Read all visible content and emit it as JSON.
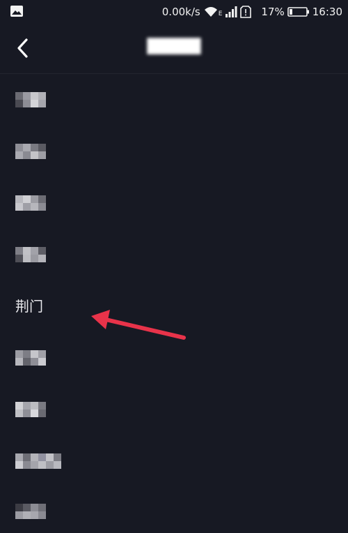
{
  "status_bar": {
    "network_speed": "0.00k/s",
    "network_type": "E",
    "battery_percent": "17%",
    "battery_level": 0.17,
    "time": "16:30",
    "icons": [
      "image-icon",
      "wifi-icon",
      "signal-icon",
      "sim-alert-icon",
      "battery-icon"
    ]
  },
  "header": {
    "back_icon": "chevron-left-icon",
    "title": "█████"
  },
  "list": {
    "highlighted_item": {
      "label": "荆门"
    }
  },
  "annotation": {
    "arrow_color": "#e8334a"
  }
}
